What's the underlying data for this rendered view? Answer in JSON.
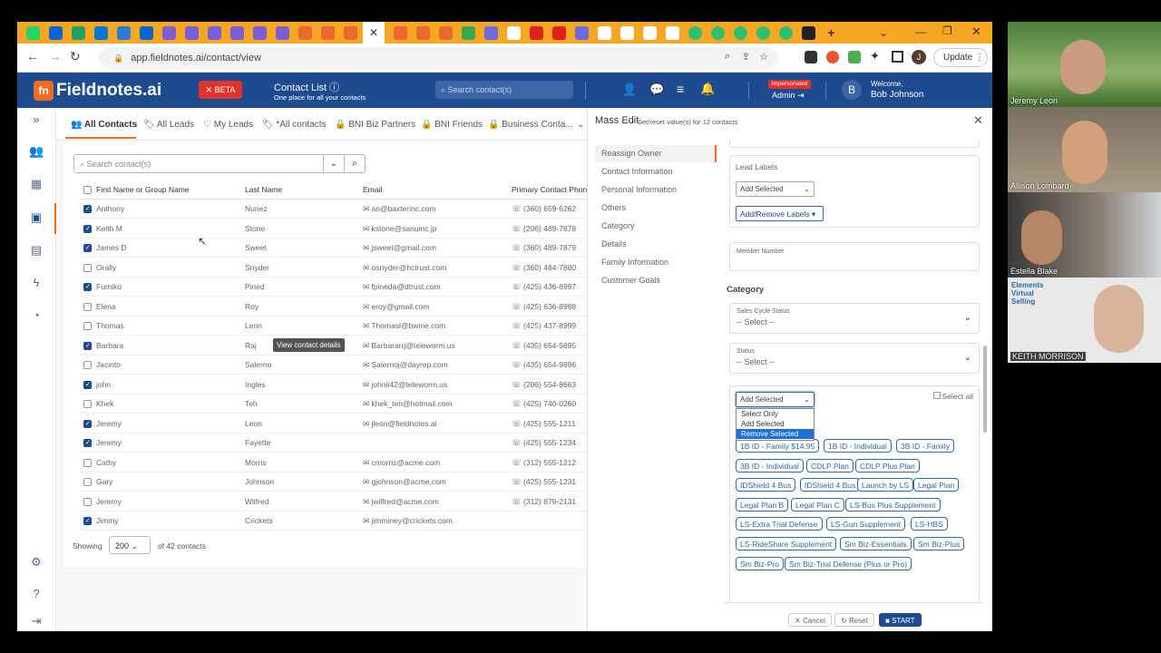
{
  "browser": {
    "tabs_icons": [
      "whatsapp",
      "outlook",
      "sheets",
      "onedrive",
      "docs",
      "outlook",
      "s",
      "s",
      "s",
      "s",
      "s",
      "s",
      "doc",
      "doc",
      "doc",
      "close",
      "doc",
      "doc",
      "doc",
      "sheet",
      "ext",
      "google",
      "youtube",
      "youtube",
      "ext",
      "google",
      "square",
      "square",
      "google",
      "circle",
      "circle",
      "circle",
      "circle",
      "circle",
      "amazon"
    ],
    "url": "app.fieldnotes.ai/contact/view",
    "update_label": "Update",
    "profile_letter": "J"
  },
  "header": {
    "logo": "Fieldnotes.ai",
    "beta": "BETA",
    "page_title": "Contact List",
    "page_sub": "One place for all your contacts",
    "search_placeholder": "Search contact(s)",
    "impersonated": "Impersonated",
    "admin": "Admin",
    "welcome": "Welcome,",
    "user": "Bob Johnson",
    "avatar": "B"
  },
  "filters": {
    "tabs": [
      "All Contacts",
      "All Leads",
      "My Leads",
      "*All contacts",
      "BNI Biz Partners",
      "BNI Friends",
      "Business Conta..."
    ]
  },
  "table": {
    "search_placeholder": "Search contact(s)",
    "headers": [
      "First Name or Group Name",
      "Last Name",
      "Email",
      "Primary Contact Phone"
    ],
    "rows": [
      {
        "checked": true,
        "first": "Anthony",
        "last": "Nunez",
        "email": "an@baxterinc.com",
        "phone": "(360) 659-6262"
      },
      {
        "checked": true,
        "first": "Keith M",
        "last": "Stone",
        "email": "kstone@sanuinc.jp",
        "phone": "(206) 489-7878"
      },
      {
        "checked": true,
        "first": "James D",
        "last": "Sweet",
        "email": "jsweet@gmail.com",
        "phone": "(360) 489-7879"
      },
      {
        "checked": false,
        "first": "Orally",
        "last": "Snyder",
        "email": "osnyder@hctrust.com",
        "phone": "(360) 484-7880"
      },
      {
        "checked": true,
        "first": "Fumiko",
        "last": "Pined",
        "email": "fpineda@dtrust.com",
        "phone": "(425) 436-8997"
      },
      {
        "checked": false,
        "first": "Elena",
        "last": "Roy",
        "email": "eroy@gmail.com",
        "phone": "(425) 636-8998"
      },
      {
        "checked": false,
        "first": "Thomas",
        "last": "Leon",
        "email": "Thomasl@bwine.com",
        "phone": "(425) 437-8999"
      },
      {
        "checked": true,
        "first": "Barbara",
        "last": "Raj",
        "email": "Barbararrj@teleworm.us",
        "phone": "(435) 654-9895"
      },
      {
        "checked": false,
        "first": "Jacinto",
        "last": "Salerno",
        "email": "Salernoj@dayrep.com",
        "phone": "(435) 654-9896"
      },
      {
        "checked": true,
        "first": "john",
        "last": "Ingles",
        "email": "johnii42@teleworm.us",
        "phone": "(206) 554-8663"
      },
      {
        "checked": false,
        "first": "Khek",
        "last": "Teh",
        "email": "khek_teh@hotmail.com",
        "phone": "(425) 740-0260"
      },
      {
        "checked": true,
        "first": "Jeremy",
        "last": "Leon",
        "email": "jleon@fieldnotes.ai",
        "phone": "(425) 555-1211"
      },
      {
        "checked": true,
        "first": "Jeremy",
        "last": "Fayette",
        "email": "",
        "phone": "(425) 555-1234"
      },
      {
        "checked": false,
        "first": "Cathy",
        "last": "Morris",
        "email": "cmorris@acme.com",
        "phone": "(312) 555-1212"
      },
      {
        "checked": false,
        "first": "Gary",
        "last": "Johnson",
        "email": "gjohnson@acme.com",
        "phone": "(425) 555-1231"
      },
      {
        "checked": false,
        "first": "Jeremy",
        "last": "Wilfred",
        "email": "jwilfred@acme.com",
        "phone": "(312) 879-2131"
      },
      {
        "checked": true,
        "first": "Jimmy",
        "last": "Crickets",
        "email": "jimminey@crickets.com",
        "phone": ""
      }
    ],
    "tooltip": "View contact details",
    "showing": "Showing",
    "page_size": "200",
    "of_contacts": "of 42 contacts"
  },
  "panel": {
    "title": "Mass Edit",
    "subtitle": "Set/reset value(s) for",
    "count": "12",
    "subtitle2": "contacts",
    "nav": [
      "Reassign Owner",
      "Contact Information",
      "Personal Information",
      "Others",
      "Category",
      "Details",
      "Family Information",
      "Customer Goals"
    ],
    "lead_labels": "Lead Labels",
    "add_selected": "Add Selected",
    "add_remove_labels": "Add/Remove Labels",
    "member_number": "Member Number",
    "category": "Category",
    "sales_cycle": "Sales Cycle Status",
    "select_placeholder": "-- Select --",
    "status": "Status",
    "select_all": "Select all",
    "dropdown_selected": "Add Selected",
    "dropdown_options": [
      "Select Only",
      "Add Selected",
      "Remove Selected"
    ],
    "tags": [
      "1B ID - Family $14.95",
      "1B ID - Individual",
      "3B ID - Family",
      "3B ID - Individual",
      "CDLP Plan",
      "CDLP Plus Plan",
      "IDShield 4 Bus",
      "IDShield 4 Bus",
      "Launch by LS",
      "Legal Plan",
      "Legal Plan B",
      "Legal Plan C",
      "LS-Bus Plus Supplement",
      "LS-Extra Trial Defense",
      "LS-Gun Supplement",
      "LS-HBS",
      "LS-RideShare Supplement",
      "Sm Biz-Essentials",
      "Sm Biz-Plus",
      "Sm Biz-Pro",
      "Sm Biz-Trial Defense (Plus or Pro)"
    ],
    "cancel": "Cancel",
    "reset": "Reset",
    "start": "START"
  },
  "video": {
    "participants": [
      "Jeremy Leon",
      "Allison Lombard",
      "Estella Blake",
      "KEITH MORRISON"
    ],
    "tile_text": "Elements Virtual Selling"
  }
}
